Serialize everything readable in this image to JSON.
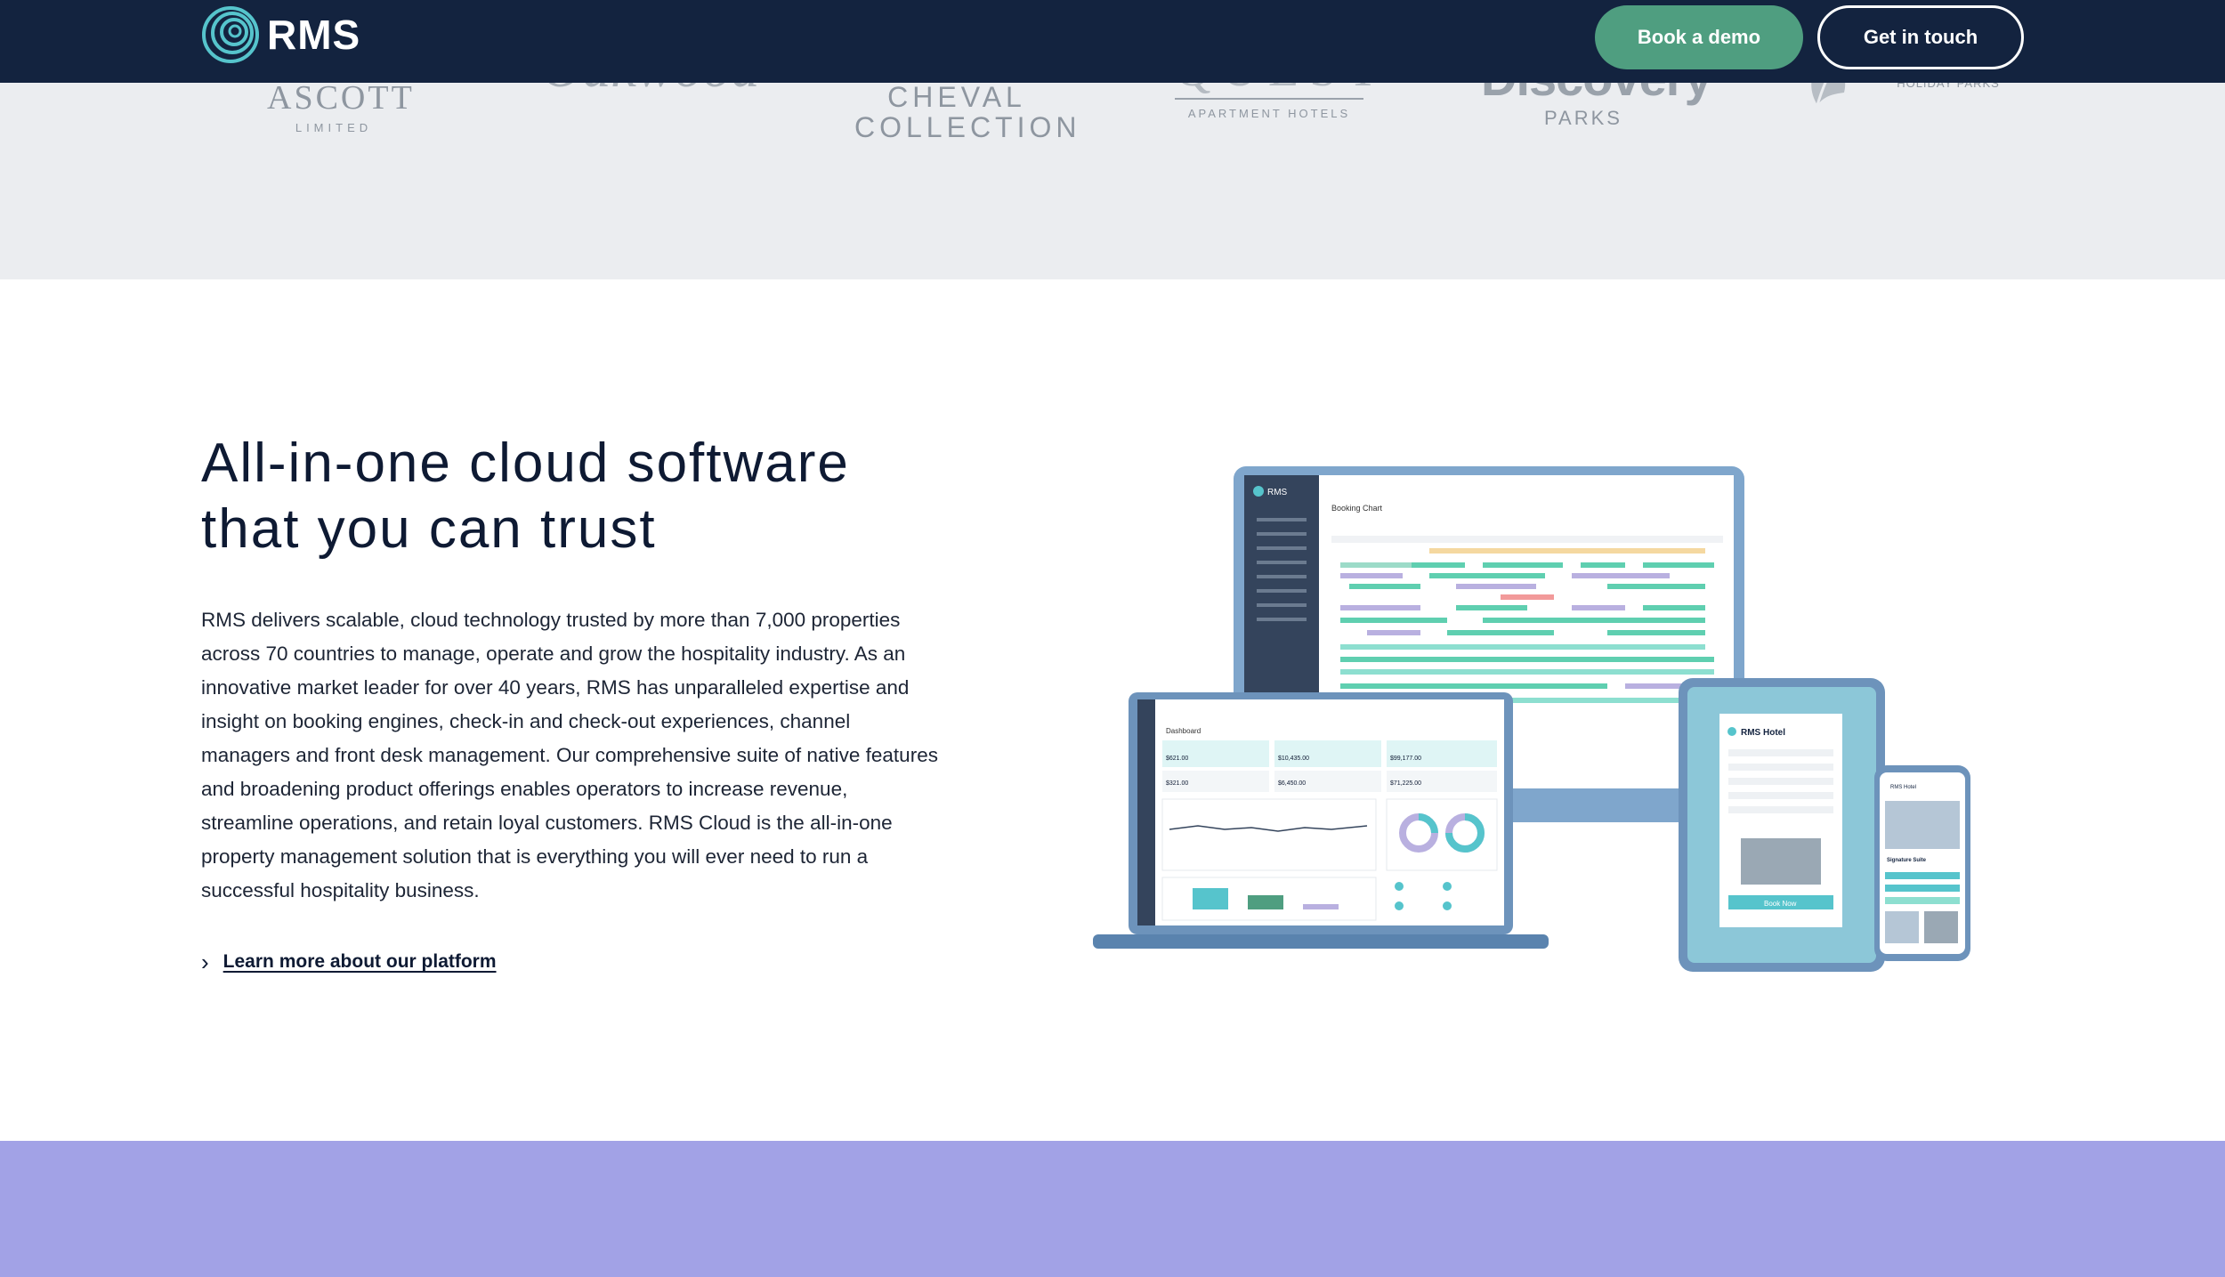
{
  "header": {
    "brand": "RMS",
    "book_demo": "Book a demo",
    "get_in_touch": "Get in touch"
  },
  "partners": {
    "ascott": "ASCOTT",
    "ascott_sub": "LIMITED",
    "oakwood": "Oakwood",
    "cheval_line1": "CHEVAL",
    "cheval_line2": "COLLECTION",
    "quest": "QUEST",
    "quest_sub": "APARTMENT HOTELS",
    "discovery": "Discovery",
    "discovery_sub": "PARKS",
    "holiday": "HOLIDAY PARKS"
  },
  "main": {
    "headline_line1": "All-in-one cloud software",
    "headline_line2": "that you can trust",
    "body": "RMS delivers scalable, cloud technology trusted by more than 7,000 properties across 70 countries to manage, operate and grow the hospitality industry. As an innovative market leader for over 40 years, RMS has unparalleled expertise and insight on booking engines, check-in and check-out experiences, channel managers and front desk management. Our comprehensive suite of native features and broadening product offerings enables operators to increase revenue, streamline operations, and retain loyal customers. RMS Cloud is the all-in-one property management solution that is everything you will ever need to run a successful hospitality business.",
    "learn_more": "Learn more about our platform"
  },
  "devices": {
    "monitor_title": "Booking Chart",
    "laptop_title": "Dashboard",
    "laptop_stats": [
      "$621.00",
      "$10,435.00",
      "$99,177.00",
      "$321.00",
      "$6,450.00",
      "$71,225.00"
    ],
    "tablet_title": "RMS Hotel",
    "tablet_button": "Book Now",
    "phone_title": "RMS Hotel",
    "phone_heading": "Signature Suite"
  },
  "colors": {
    "header_bg": "#13233f",
    "accent_green": "#4f9e80",
    "logo_strip_bg": "#ebedf0",
    "footer_band": "#a2a2e6"
  }
}
